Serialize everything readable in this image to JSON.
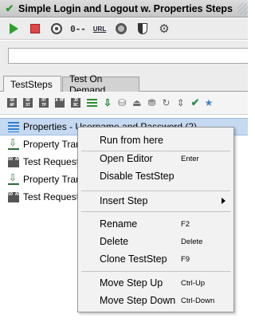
{
  "window": {
    "title": "Simple Login and Logout w. Properties Steps"
  },
  "toolbar": {
    "icons": [
      "run-icon",
      "stop-icon",
      "target-icon",
      "key-icon",
      "url-icon",
      "dial-icon",
      "shield-icon",
      "gear-icon"
    ],
    "key_text": "0--",
    "url_text": "URL"
  },
  "search": {
    "value": "",
    "placeholder": ""
  },
  "tabs": [
    {
      "label": "TestSteps",
      "active": true
    },
    {
      "label": "Test On Demand",
      "active": false
    }
  ],
  "steptoolbar": {
    "icons": [
      "soap-request-icon",
      "rest-request-icon",
      "http-request-icon",
      "amf-request-icon",
      "jdbc-request-icon",
      "properties-icon",
      "property-transfer-icon",
      "mock-response-icon",
      "delay-icon",
      "run-testcase-icon",
      "script-icon",
      "move-icon",
      "assertion-icon",
      "star-icon"
    ],
    "soap": "SO AP",
    "rest": "RE ST",
    "http": "HT TP",
    "amf": "A MF",
    "jdbc": "JD BC"
  },
  "tree": {
    "items": [
      {
        "label": "Properties - Username and Password (2)",
        "icon": "properties-icon",
        "selected": true
      },
      {
        "label": "Property Trar",
        "icon": "property-transfer-icon"
      },
      {
        "label": "Test Request",
        "icon": "soap-request-icon"
      },
      {
        "label": "Property Trar",
        "icon": "property-transfer-icon"
      },
      {
        "label": "Test Request",
        "icon": "soap-request-icon"
      }
    ],
    "soap_icon_text": "SO AP"
  },
  "menu": {
    "run_from_here": {
      "label": "Run from here"
    },
    "open_editor": {
      "label": "Open Editor",
      "shortcut": "Enter"
    },
    "disable_teststep": {
      "label": "Disable TestStep"
    },
    "insert_step": {
      "label": "Insert Step"
    },
    "rename": {
      "label": "Rename",
      "shortcut": "F2"
    },
    "delete": {
      "label": "Delete",
      "shortcut": "Delete"
    },
    "clone_teststep": {
      "label": "Clone TestStep",
      "shortcut": "F9"
    },
    "move_step_up": {
      "label": "Move Step Up",
      "shortcut": "Ctrl-Up"
    },
    "move_step_down": {
      "label": "Move Step Down",
      "shortcut": "Ctrl-Down"
    }
  }
}
